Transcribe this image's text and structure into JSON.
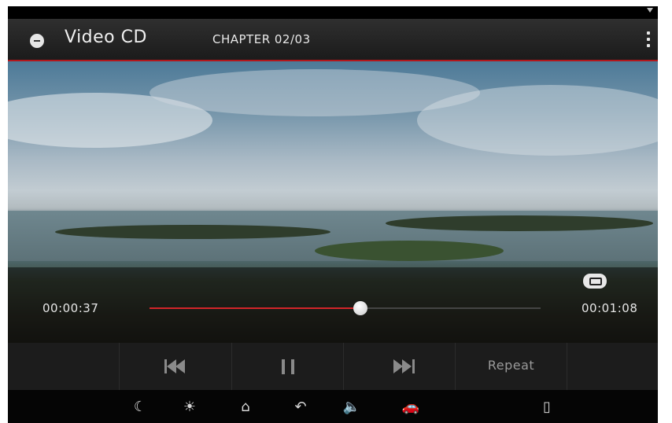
{
  "header": {
    "title": "Video CD",
    "chapter": "CHAPTER 02/03",
    "icons": {
      "source": "disc-icon",
      "menu": "more-vertical-icon"
    }
  },
  "playback": {
    "current_time": "00:00:37",
    "total_time": "00:01:08",
    "progress_fraction": 0.54,
    "repeat_indicator": "repeat-icon"
  },
  "controls": {
    "previous": "previous-track-icon",
    "pause": "pause-icon",
    "next": "next-track-icon",
    "repeat_label": "Repeat"
  },
  "nav_bar": {
    "items": [
      "night-mode-icon",
      "brightness-icon",
      "home-icon",
      "back-icon",
      "volume-icon",
      "car-icon",
      "phone-icon"
    ],
    "glyphs": [
      "☾",
      "☀",
      "⌂",
      "↶",
      "🔈",
      "🚗",
      "▯"
    ]
  },
  "colors": {
    "accent": "#d3252a",
    "header_line": "#b3161b"
  }
}
